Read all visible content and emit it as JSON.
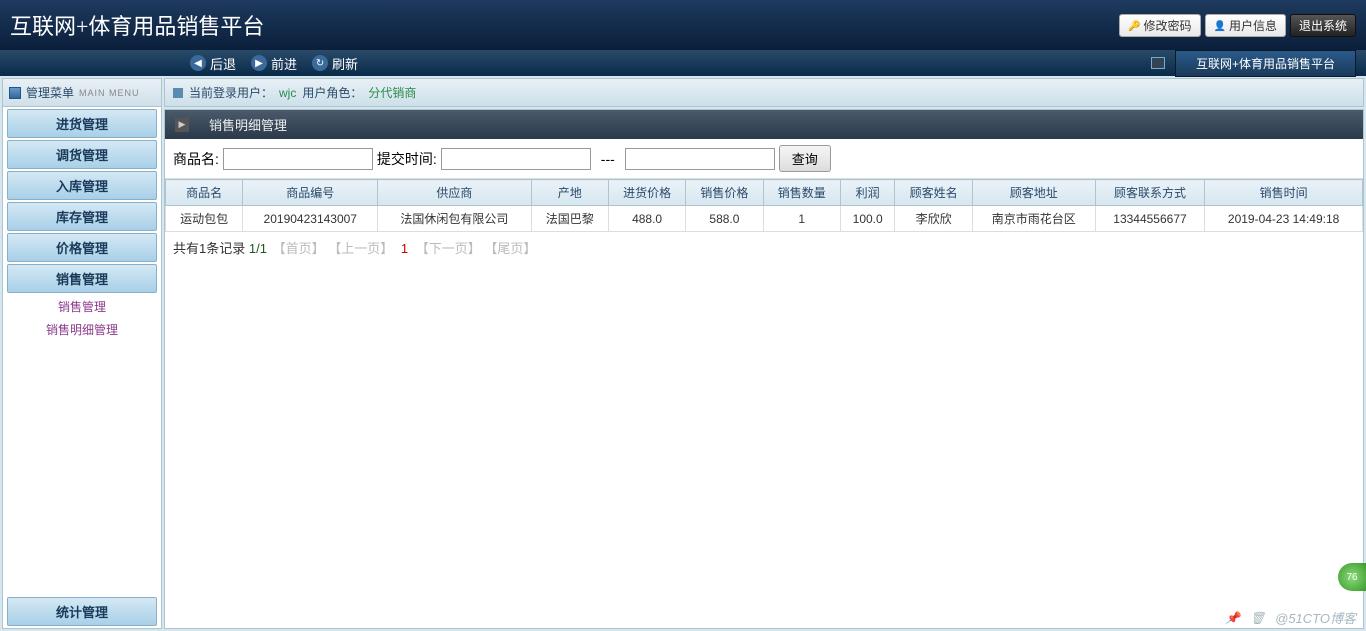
{
  "app_title": "互联网+体育用品销售平台",
  "header_buttons": {
    "change_pwd": "修改密码",
    "user_info": "用户信息",
    "logout": "退出系统"
  },
  "nav": {
    "back": "后退",
    "forward": "前进",
    "refresh": "刷新",
    "breadcrumb": "互联网+体育用品销售平台"
  },
  "sidebar": {
    "header": "管理菜单",
    "header_en": "MAIN MENU",
    "items": [
      {
        "label": "进货管理"
      },
      {
        "label": "调货管理"
      },
      {
        "label": "入库管理"
      },
      {
        "label": "库存管理"
      },
      {
        "label": "价格管理"
      },
      {
        "label": "销售管理"
      }
    ],
    "submenu": [
      {
        "label": "销售管理"
      },
      {
        "label": "销售明细管理"
      }
    ],
    "bottom_item": {
      "label": "统计管理"
    }
  },
  "user_bar": {
    "prefix": "当前登录用户：",
    "user": "wjc",
    "role_prefix": "用户角色：",
    "role": "分代销商"
  },
  "panel_title": "销售明细管理",
  "search": {
    "product_label": "商品名:",
    "submit_time_label": "提交时间:",
    "separator": "---",
    "button": "查询"
  },
  "table": {
    "headers": [
      "商品名",
      "商品编号",
      "供应商",
      "产地",
      "进货价格",
      "销售价格",
      "销售数量",
      "利润",
      "顾客姓名",
      "顾客地址",
      "顾客联系方式",
      "销售时间"
    ],
    "rows": [
      {
        "cells": [
          "运动包包",
          "20190423143007",
          "法国休闲包有限公司",
          "法国巴黎",
          "488.0",
          "588.0",
          "1",
          "100.0",
          "李欣欣",
          "南京市雨花台区",
          "13344556677",
          "2019-04-23 14:49:18"
        ]
      }
    ]
  },
  "pager": {
    "total_text": "共有1条记录",
    "page_info": "1/1",
    "first": "【首页】",
    "prev": "【上一页】",
    "current": "1",
    "next": "【下一页】",
    "last": "【尾页】"
  },
  "watermark": "@51CTO博客",
  "floating_badge": "76"
}
